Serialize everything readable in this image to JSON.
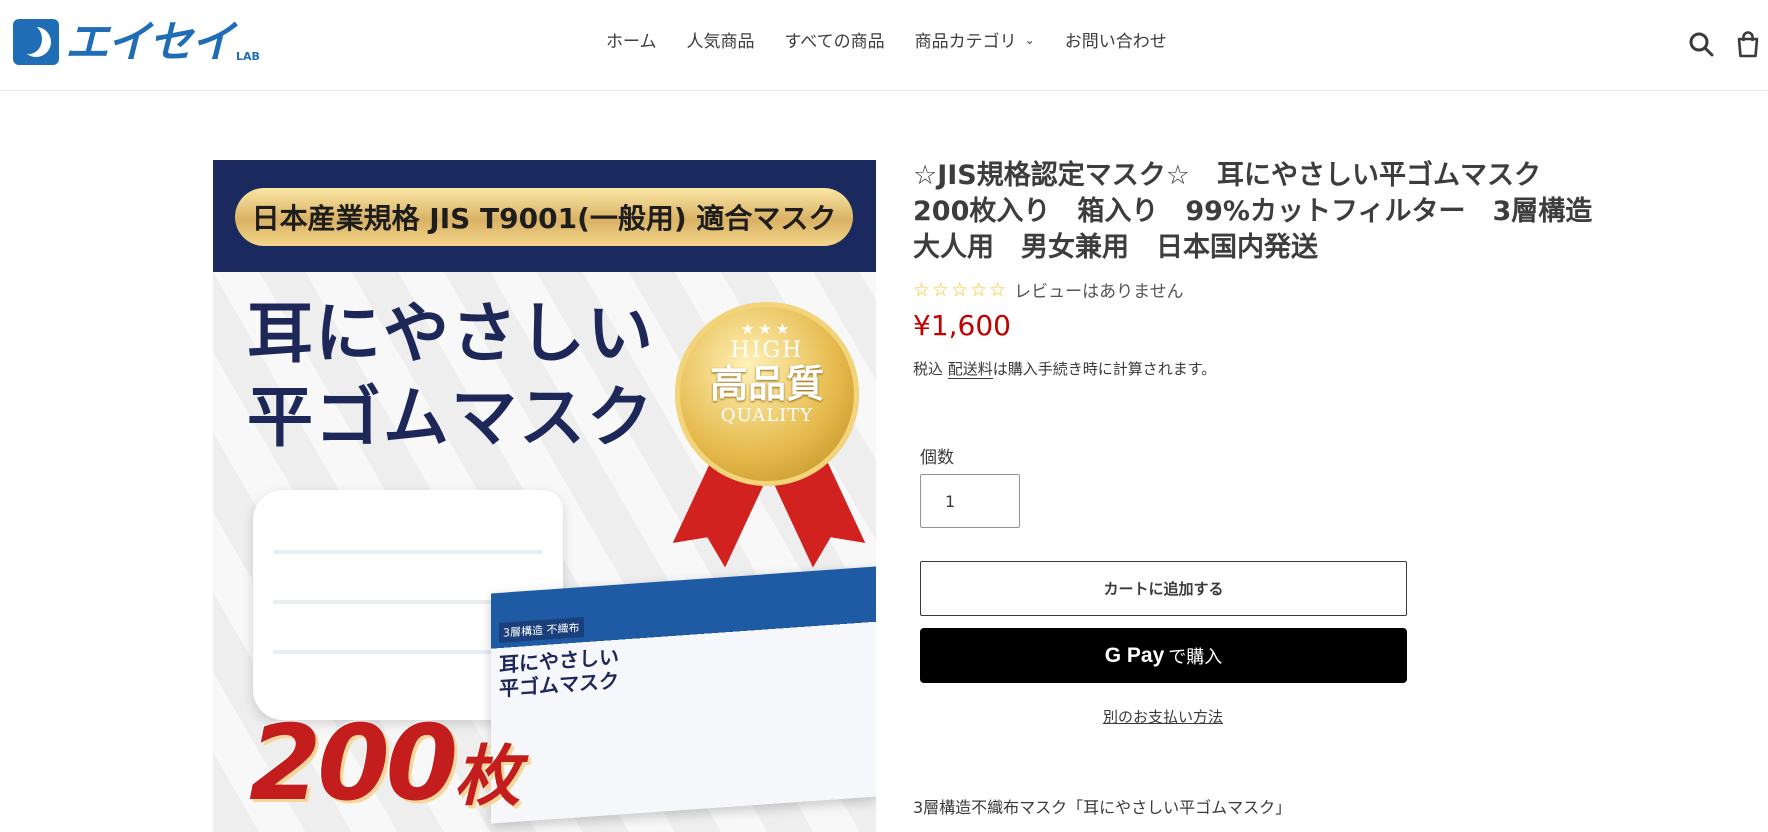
{
  "brand": {
    "logo_text": "エイセイ",
    "logo_sub": "LAB"
  },
  "nav": {
    "items": [
      "ホーム",
      "人気商品",
      "すべての商品",
      "商品カテゴリ",
      "お問い合わせ"
    ],
    "dropdown_chevron": "⌄"
  },
  "header_icons": {
    "search": "search-icon",
    "cart": "cart-icon"
  },
  "product_image": {
    "banner_text": "日本産業規格 JIS T9001(一般用) 適合マスク",
    "headline_line1": "耳にやさしい",
    "headline_line2": "平ゴムマスク",
    "medal_stars": "★★★",
    "medal_top": "HIGH",
    "medal_main": "高品質",
    "medal_bottom": "QUALITY",
    "box_tag": "3層構造 不織布",
    "box_line1": "耳にやさしい",
    "box_line2": "平ゴムマスク",
    "count_number": "200",
    "count_unit": "枚"
  },
  "product": {
    "title": "☆JIS規格認定マスク☆　耳にやさしい平ゴムマスク 200枚入り　箱入り　99%カットフィルター　3層構造　大人用　男女兼用　日本国内発送",
    "stars": "☆☆☆☆☆",
    "review_text": "レビューはありません",
    "price": "¥1,600",
    "tax_prefix": "税込 ",
    "shipping_link": "配送料",
    "tax_suffix": "は購入手続き時に計算されます。",
    "quantity_label": "個数",
    "quantity_value": "1",
    "add_to_cart": "カートに追加する",
    "gpay_brand": "G Pay",
    "gpay_suffix": "で購入",
    "other_payment": "別のお支払い方法",
    "description": "3層構造不織布マスク「耳にやさしい平ゴムマスク」"
  },
  "colors": {
    "brand_blue": "#1e6db5",
    "price_red": "#c20000",
    "star_yellow": "#f5c518"
  }
}
